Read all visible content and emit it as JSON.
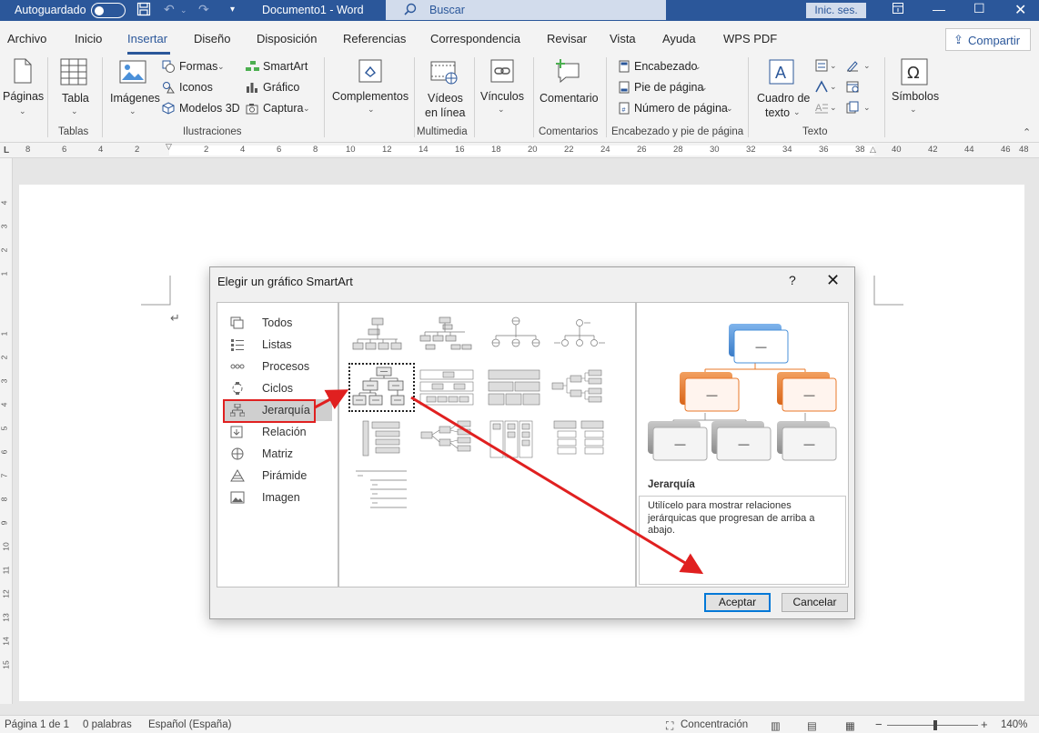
{
  "title_bar": {
    "autosave_label": "Autoguardado",
    "doc_title": "Documento1  -  Word",
    "search_placeholder": "Buscar",
    "signin_label": "Inic. ses."
  },
  "tabs": [
    "Archivo",
    "Inicio",
    "Insertar",
    "Diseño",
    "Disposición",
    "Referencias",
    "Correspondencia",
    "Revisar",
    "Vista",
    "Ayuda",
    "WPS PDF"
  ],
  "active_tab": "Insertar",
  "share_label": "Compartir",
  "ribbon": {
    "paginas": "Páginas",
    "tabla": "Tabla",
    "tablas_group": "Tablas",
    "imagenes": "Imágenes",
    "formas": "Formas",
    "iconos": "Iconos",
    "modelos3d": "Modelos 3D",
    "smartart": "SmartArt",
    "grafico": "Gráfico",
    "captura": "Captura",
    "ilustraciones_group": "Ilustraciones",
    "complementos": "Complementos",
    "videos_line1": "Vídeos",
    "videos_line2": "en línea",
    "multimedia_group": "Multimedia",
    "vinculos": "Vínculos",
    "comentario": "Comentario",
    "comentarios_group": "Comentarios",
    "encabezado": "Encabezado",
    "pie_pagina": "Pie de página",
    "numero_pagina": "Número de página",
    "encabezado_group": "Encabezado y pie de página",
    "cuadro_texto_line1": "Cuadro de",
    "cuadro_texto_line2": "texto",
    "texto_group": "Texto",
    "simbolos": "Símbolos"
  },
  "ruler_numbers": [
    "8",
    "6",
    "4",
    "2",
    "2",
    "4",
    "6",
    "8",
    "10",
    "12",
    "14",
    "16",
    "18",
    "20",
    "22",
    "24",
    "26",
    "28",
    "30",
    "32",
    "34",
    "36",
    "38",
    "40",
    "42",
    "44",
    "46",
    "48"
  ],
  "vruler_numbers": [
    "4",
    "3",
    "2",
    "1",
    "1",
    "2",
    "3",
    "4",
    "5",
    "6",
    "7",
    "8",
    "9",
    "10",
    "11",
    "12",
    "13",
    "14",
    "15"
  ],
  "dialog": {
    "title": "Elegir un gráfico SmartArt",
    "help": "?",
    "categories": [
      "Todos",
      "Listas",
      "Procesos",
      "Ciclos",
      "Jerarquía",
      "Relación",
      "Matriz",
      "Pirámide",
      "Imagen"
    ],
    "selected_category": "Jerarquía",
    "preview_title": "Jerarquía",
    "preview_description": "Utilícelo para mostrar relaciones jerárquicas que progresan de arriba a abajo.",
    "preview_placeholder": "—",
    "ok_label": "Aceptar",
    "cancel_label": "Cancelar"
  },
  "status_bar": {
    "page": "Página 1 de 1",
    "words": "0 palabras",
    "language": "Español (España)",
    "focus": "Concentración",
    "zoom": "140%"
  },
  "colors": {
    "word_blue": "#2b579a",
    "highlight_red": "#e02020",
    "preview_blue": "#4a90d9",
    "preview_orange": "#e8782a",
    "preview_gray": "#a6a6a6"
  }
}
